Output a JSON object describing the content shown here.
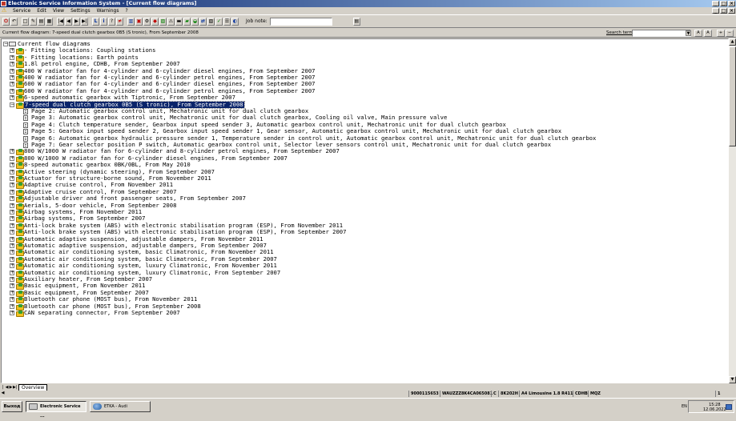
{
  "window": {
    "title": "Electronic Service Information System - [Current flow diagrams]"
  },
  "menu": [
    "Service",
    "Edit",
    "View",
    "Settings",
    "Warnings",
    "?"
  ],
  "toolbar": {
    "job_note_label": "Job note:",
    "job_note_value": ""
  },
  "status": {
    "current_flow_diagram": "Current flow diagram: 7-speed dual clutch gearbox 0B5 (S tronic), From September 2008",
    "search_label": "Search term:",
    "search_value": ""
  },
  "tree": {
    "root": "Current flow diagrams",
    "items": [
      {
        "label": "- Fitting locations: Coupling stations",
        "type": "folder",
        "expanded": false
      },
      {
        "label": "- Fitting locations: Earth points",
        "type": "folder",
        "expanded": false
      },
      {
        "label": "1.8l petrol engine, CDHB, From September 2007",
        "type": "folder",
        "expanded": false
      },
      {
        "label": "400 W radiator fan for 4-cylinder and 6-cylinder diesel engines, From September 2007",
        "type": "folder",
        "expanded": false
      },
      {
        "label": "400 W radiator fan for 4-cylinder and 6-cylinder petrol engines, From September 2007",
        "type": "folder",
        "expanded": false
      },
      {
        "label": "600 W radiator fan for 4-cylinder and 6-cylinder diesel engines, From September 2007",
        "type": "folder",
        "expanded": false
      },
      {
        "label": "600 W radiator fan for 4-cylinder and 6-cylinder petrol engines, From September 2007",
        "type": "folder",
        "expanded": false
      },
      {
        "label": "6-speed automatic gearbox with Tiptronic, From September 2007",
        "type": "folder",
        "expanded": false
      },
      {
        "label": "7-speed dual clutch gearbox 0B5 (S tronic), From September 2008",
        "type": "folder",
        "expanded": true,
        "selected": true
      },
      {
        "label": "Page 2: Automatic gearbox control unit, Mechatronic unit for dual clutch gearbox",
        "type": "page"
      },
      {
        "label": "Page 3: Automatic gearbox control unit, Mechatronic unit for dual clutch gearbox, Cooling oil valve, Main pressure valve",
        "type": "page"
      },
      {
        "label": "Page 4: Clutch temperature sender, Gearbox input speed sender 3, Automatic gearbox control unit, Mechatronic unit for dual clutch gearbox",
        "type": "page"
      },
      {
        "label": "Page 5: Gearbox input speed sender 2, Gearbox input speed sender 1, Gear sensor, Automatic gearbox control unit, Mechatronic unit for dual clutch gearbox",
        "type": "page"
      },
      {
        "label": "Page 6: Automatic gearbox hydraulic pressure sender 1, Temperature sender in control unit, Automatic gearbox control unit, Mechatronic unit for dual clutch gearbox",
        "type": "page"
      },
      {
        "label": "Page 7: Gear selector position P switch, Automatic gearbox control unit, Selector lever sensors control unit, Mechatronic unit for dual clutch gearbox",
        "type": "page"
      },
      {
        "label": "800 W/1000 W radiator fan for 6-cylinder and 8-cylinder petrol engines, From September 2007",
        "type": "folder",
        "expanded": false
      },
      {
        "label": "800 W/1000 W radiator fan for 6-cylinder diesel engines, From September 2007",
        "type": "folder",
        "expanded": false
      },
      {
        "label": "8-speed automatic gearbox 0BK/0BL, From May 2010",
        "type": "folder",
        "expanded": false
      },
      {
        "label": "Active steering (dynamic steering), From September 2007",
        "type": "folder",
        "expanded": false
      },
      {
        "label": "Actuator for structure-borne sound, From November 2011",
        "type": "folder",
        "expanded": false
      },
      {
        "label": "Adaptive cruise control, From November 2011",
        "type": "folder",
        "expanded": false
      },
      {
        "label": "Adaptive cruise control, From September 2007",
        "type": "folder",
        "expanded": false
      },
      {
        "label": "Adjustable driver and front passenger seats, From September 2007",
        "type": "folder",
        "expanded": false
      },
      {
        "label": "Aerials, 5-door vehicle, From September 2008",
        "type": "folder",
        "expanded": false
      },
      {
        "label": "Airbag systems, From November 2011",
        "type": "folder",
        "expanded": false
      },
      {
        "label": "Airbag systems, From September 2007",
        "type": "folder",
        "expanded": false
      },
      {
        "label": "Anti-lock brake system (ABS) with electronic stabilisation program (ESP), From November 2011",
        "type": "folder",
        "expanded": false
      },
      {
        "label": "Anti-lock brake system (ABS) with electronic stabilisation program (ESP), From September 2007",
        "type": "folder",
        "expanded": false
      },
      {
        "label": "Automatic adaptive suspension, adjustable dampers, From November 2011",
        "type": "folder",
        "expanded": false
      },
      {
        "label": "Automatic adaptive suspension, adjustable dampers, From September 2007",
        "type": "folder",
        "expanded": false
      },
      {
        "label": "Automatic air conditioning system, basic Climatronic, From November 2011",
        "type": "folder",
        "expanded": false
      },
      {
        "label": "Automatic air conditioning system, basic Climatronic, From September 2007",
        "type": "folder",
        "expanded": false
      },
      {
        "label": "Automatic air conditioning system, luxury Climatronic, From November 2011",
        "type": "folder",
        "expanded": false
      },
      {
        "label": "Automatic air conditioning system, luxury Climatronic, From September 2007",
        "type": "folder",
        "expanded": false
      },
      {
        "label": "Auxiliary heater, From September 2007",
        "type": "folder",
        "expanded": false
      },
      {
        "label": "Basic equipment, From November 2011",
        "type": "folder",
        "expanded": false
      },
      {
        "label": "Basic equipment, From September 2007",
        "type": "folder",
        "expanded": false
      },
      {
        "label": "Bluetooth car phone (MOST bus), From November 2011",
        "type": "folder",
        "expanded": false
      },
      {
        "label": "Bluetooth car phone (MOST bus), From September 2008",
        "type": "folder",
        "expanded": false
      },
      {
        "label": "CAN separating connector, From September 2007",
        "type": "folder",
        "expanded": false
      }
    ]
  },
  "tabs": [
    "Overview"
  ],
  "infobar": {
    "order": "9000115653",
    "vin": "WAUZZZ8K4CA065081",
    "c": "C",
    "type": "8K202H",
    "model": "A4 Limousine 1.8 R411",
    "engine": "CDHB",
    "gearbox": "MQZ",
    "page": "1"
  },
  "taskbar": {
    "start_label": "Выход",
    "tasks": [
      {
        "label": "Electronic Service ...",
        "active": true
      },
      {
        "label": "ETKA - Audi",
        "active": false
      }
    ],
    "lang": "EN",
    "time": "15:28",
    "date": "12.06.2022"
  },
  "colors": {
    "titlebar_start": "#0a246a",
    "titlebar_end": "#a6caf0",
    "selection": "#0a246a",
    "window_bg": "#d4d0c8"
  }
}
